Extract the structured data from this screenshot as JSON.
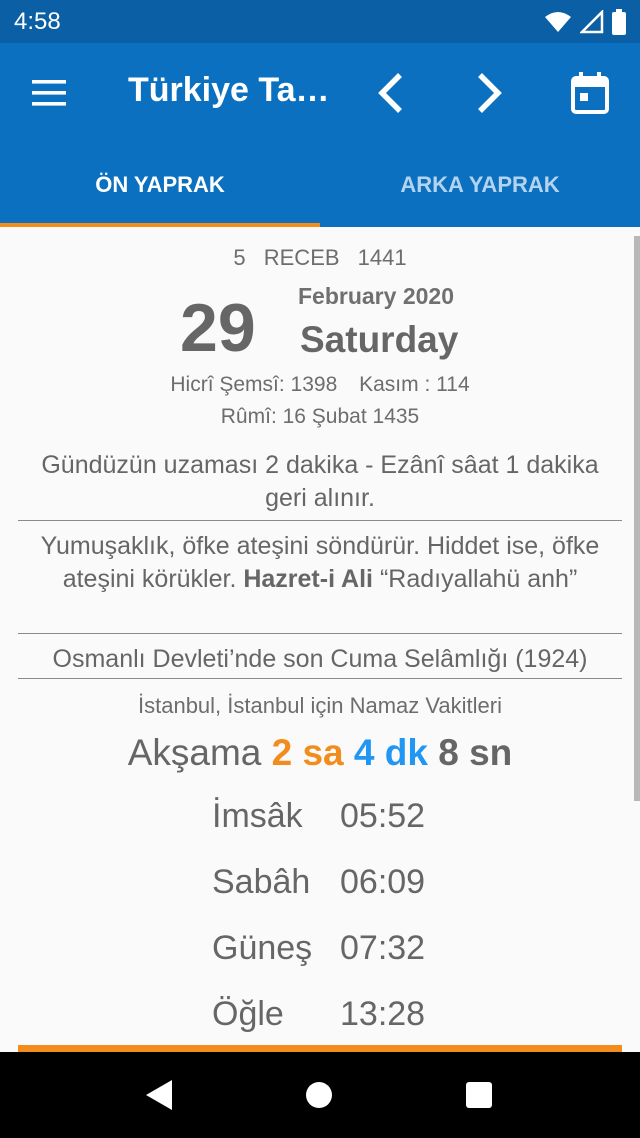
{
  "status": {
    "time": "4:58"
  },
  "appbar": {
    "title": "Türkiye Ta…"
  },
  "tabs": [
    {
      "label": "ÖN YAPRAK"
    },
    {
      "label": "ARKA YAPRAK"
    }
  ],
  "calendar": {
    "hijri": {
      "day": "5",
      "month": "RECEB",
      "year": "1441"
    },
    "day": "29",
    "month_year": "February 2020",
    "weekday": "Saturday",
    "hicri_semsi": "Hicrî Şemsî: 1398",
    "kasim": "Kasım : 114",
    "rumi": "Rûmî: 16 Şubat 1435"
  },
  "notes": {
    "daylight": "Gündüzün uzaması 2 dakika - Ezânî sâat 1 dakika geri alınır.",
    "quote_text": "Yumuşaklık, öfke ateşini söndürür. Hiddet ise, öfke ateşini körükler. ",
    "quote_author": "Hazret-i Ali",
    "quote_suffix": " “Radıyallahü anh”",
    "history": "Osmanlı Devleti’nde son Cuma Selâmlığı (1924)"
  },
  "prayer": {
    "title": "İstanbul, İstanbul için Namaz Vakitleri",
    "countdown": {
      "label": "Akşama ",
      "hours": "2 sa",
      "minutes": "4 dk",
      "seconds": "8 sn"
    },
    "times": [
      {
        "name": "İmsâk",
        "time": "05:52"
      },
      {
        "name": "Sabâh",
        "time": "06:09"
      },
      {
        "name": "Güneş",
        "time": "07:32"
      },
      {
        "name": "Öğle",
        "time": "13:28"
      }
    ]
  },
  "colors": {
    "appbar": "#0a70bf",
    "statusbar": "#0a5fa5",
    "accent": "#f28c1c",
    "minutes": "#2196f3"
  }
}
